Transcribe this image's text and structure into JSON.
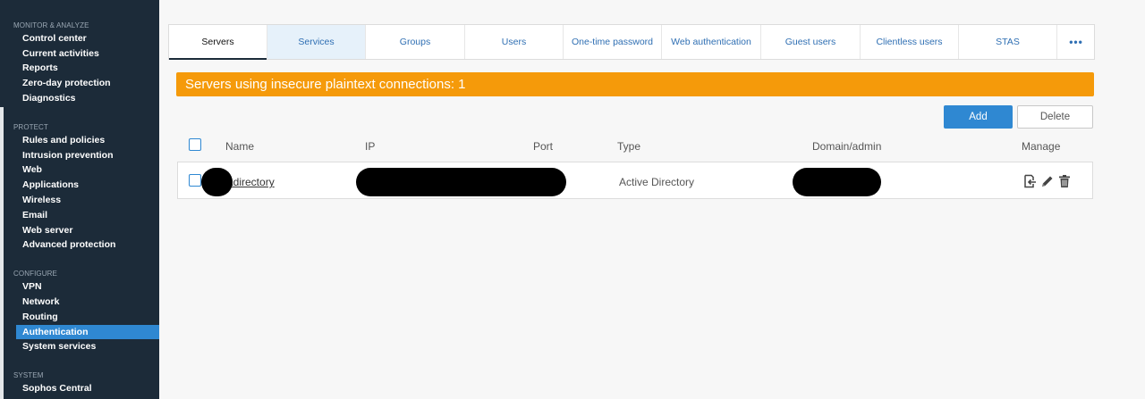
{
  "sidebar": {
    "monitor": {
      "title": "MONITOR & ANALYZE",
      "items": [
        "Control center",
        "Current activities",
        "Reports",
        "Zero-day protection",
        "Diagnostics"
      ]
    },
    "protect": {
      "title": "PROTECT",
      "items": [
        "Rules and policies",
        "Intrusion prevention",
        "Web",
        "Applications",
        "Wireless",
        "Email",
        "Web server",
        "Advanced protection"
      ]
    },
    "configure": {
      "title": "CONFIGURE",
      "items": [
        "VPN",
        "Network",
        "Routing",
        "Authentication",
        "System services"
      ],
      "active": "Authentication"
    },
    "system": {
      "title": "SYSTEM",
      "items": [
        "Sophos Central"
      ]
    }
  },
  "tabs": [
    "Servers",
    "Services",
    "Groups",
    "Users",
    "One-time password",
    "Web authentication",
    "Guest users",
    "Clientless users",
    "STAS"
  ],
  "tabs_more": "•••",
  "selected_tab": "Servers",
  "banner": {
    "text": "Servers using insecure plaintext connections: 1",
    "color": "#f59a0a"
  },
  "actions": {
    "add": "Add",
    "delete": "Delete"
  },
  "table": {
    "headers": {
      "name": "Name",
      "ip": "IP",
      "port": "Port",
      "type": "Type",
      "domain": "Domain/admin",
      "manage": "Manage"
    },
    "rows": [
      {
        "name": "adirectory",
        "type": "Active Directory"
      }
    ]
  },
  "colors": {
    "sidebar_bg": "#1c2b39",
    "accent": "#2f88d2",
    "warning": "#f59a0a"
  }
}
